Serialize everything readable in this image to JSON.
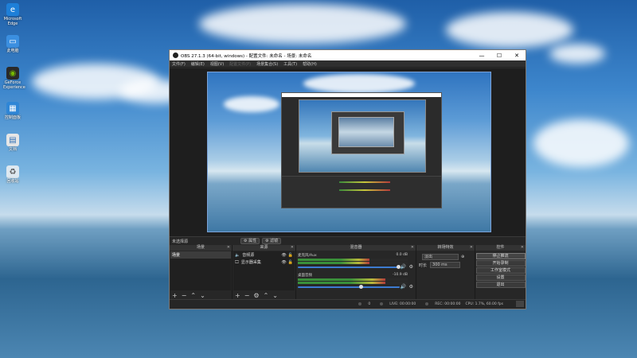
{
  "desktop": {
    "icons": [
      {
        "label": "Microsoft Edge",
        "icon": "edge-icon",
        "color": "#1e7fd8"
      },
      {
        "label": "此电脑",
        "icon": "computer-icon",
        "color": "#3b8fe0"
      },
      {
        "label": "GeForce Experience",
        "icon": "nvidia-icon",
        "color": "#2a2a2a"
      },
      {
        "label": "控制面板",
        "icon": "control-panel-icon",
        "color": "#2f86d6"
      },
      {
        "label": "文档",
        "icon": "document-icon",
        "color": "#e6e6e6"
      },
      {
        "label": "回收站",
        "icon": "recycle-bin-icon",
        "color": "#dde8f0"
      }
    ]
  },
  "window": {
    "title": "OBS 27.1.3 (64-bit, windows) - 配置文件: 未命名 - 场景: 未命名",
    "menu": [
      {
        "label": "文件(F)",
        "disabled": false
      },
      {
        "label": "编辑(E)",
        "disabled": false
      },
      {
        "label": "视图(V)",
        "disabled": false
      },
      {
        "label": "配置文件(P)",
        "disabled": true
      },
      {
        "label": "场景集合(S)",
        "disabled": false
      },
      {
        "label": "工具(T)",
        "disabled": false
      },
      {
        "label": "帮助(H)",
        "disabled": false
      }
    ],
    "minimize": "—",
    "maximize": "☐",
    "close": "✕"
  },
  "subbar": {
    "no_source": "未选择源",
    "properties": "属性",
    "filters": "滤镜"
  },
  "scenes": {
    "title": "场景",
    "items": [
      "场景"
    ]
  },
  "sources": {
    "title": "来源",
    "items": [
      {
        "name": "音频源"
      },
      {
        "name": "显示器采集"
      }
    ]
  },
  "mixer": {
    "title": "混音器",
    "tracks": [
      {
        "name": "麦克风/Aux",
        "db": "0.0 dB",
        "level": 0.65,
        "volume": 1.0
      },
      {
        "name": "桌面音频",
        "db": "-10.9 dB",
        "level": 0.8,
        "volume": 0.62
      }
    ]
  },
  "transitions": {
    "title": "转场特效",
    "type": "淡出",
    "duration_label": "时长",
    "duration_value": "300 ms"
  },
  "controls": {
    "title": "控件",
    "buttons": [
      "停止推流",
      "开始录制",
      "工作室模式",
      "设置",
      "退出"
    ]
  },
  "status": {
    "dropped": "0",
    "live": "LIVE: 00:00:00",
    "rec": "REC: 00:00:00",
    "cpu": "CPU: 1.7%, 60.00 fps"
  }
}
